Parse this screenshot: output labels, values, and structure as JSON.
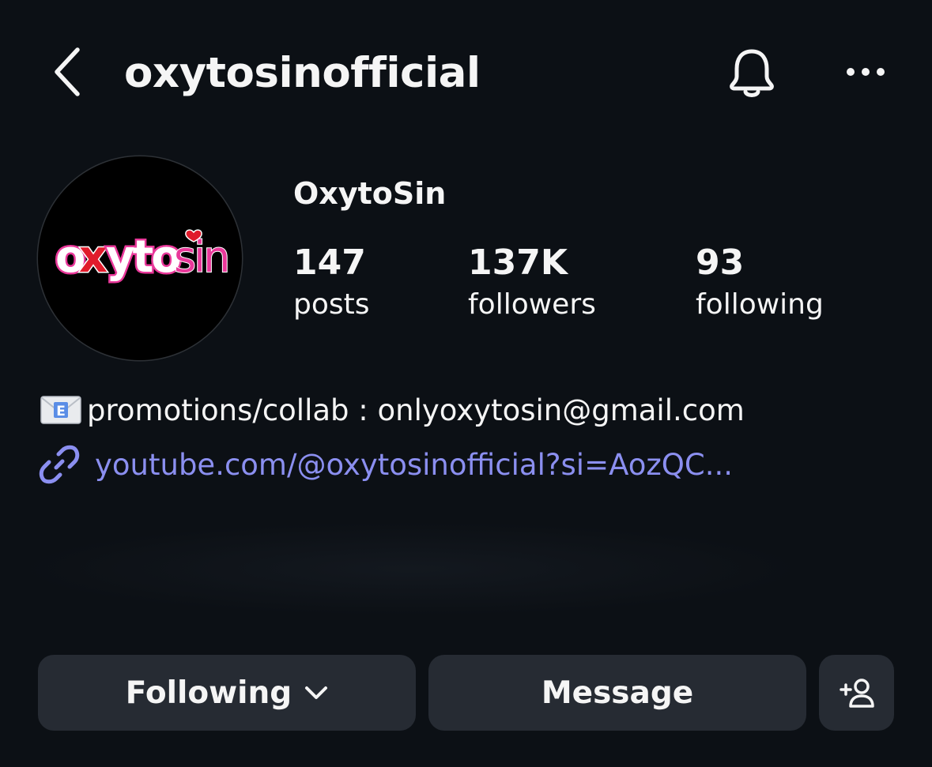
{
  "header": {
    "username": "oxytosinofficial",
    "back_icon": "chevron-left-icon",
    "bell_icon": "bell-icon",
    "more_icon": "more-horizontal-icon"
  },
  "profile": {
    "display_name": "OxytoSin",
    "avatar_logo_text": "oxytosin",
    "stats": {
      "posts": {
        "value": "147",
        "label": "posts"
      },
      "followers": {
        "value": "137K",
        "label": "followers"
      },
      "following": {
        "value": "93",
        "label": "following"
      }
    },
    "bio": {
      "email_line": "promotions/collab : onlyoxytosin@gmail.com",
      "email_icon": "envelope-emoji-icon",
      "link_icon": "link-icon",
      "link_text": "youtube.com/@oxytosinofficial?si=AozQC..."
    }
  },
  "actions": {
    "following_label": "Following",
    "message_label": "Message",
    "add_user_icon": "add-user-icon"
  },
  "colors": {
    "background": "#0c1015",
    "button_bg": "#262b33",
    "link": "#8b8ff0",
    "text": "#f5f5f5",
    "logo_pink": "#e9389a",
    "logo_red": "#e01b2b"
  }
}
